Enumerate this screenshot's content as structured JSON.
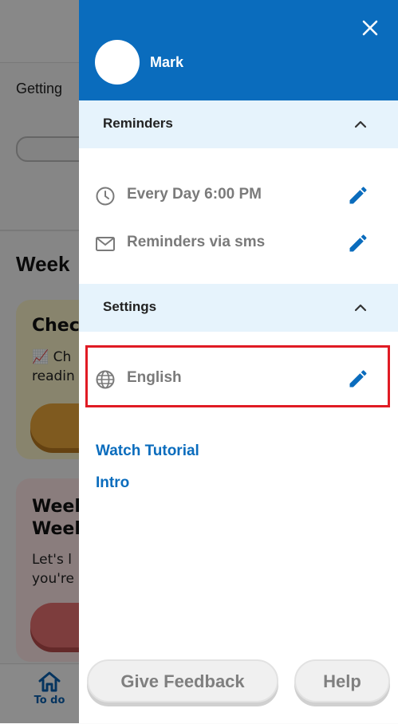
{
  "background": {
    "getting_text": "Getting",
    "week_text": "Week",
    "card1": {
      "title": "Chec",
      "text_line1": "📈 Ch",
      "text_line2": "readin"
    },
    "card2": {
      "title_line1": "Weel",
      "title_line2": "Weel",
      "text_line1": "Let's l",
      "text_line2": "you're"
    },
    "tab_home_label": "To do"
  },
  "drawer": {
    "user_name": "Mark",
    "reminders": {
      "title": "Reminders",
      "items": [
        {
          "label": "Every Day 6:00 PM",
          "icon": "clock-icon"
        },
        {
          "label": "Reminders via sms",
          "icon": "mail-icon"
        }
      ]
    },
    "settings": {
      "title": "Settings",
      "items": [
        {
          "label": "English",
          "icon": "globe-icon"
        }
      ]
    },
    "links": {
      "watch_tutorial": "Watch Tutorial",
      "intro": "Intro"
    },
    "buttons": {
      "give_feedback": "Give Feedback",
      "help": "Help"
    }
  },
  "colors": {
    "header_blue": "#0a6cbd",
    "section_bg": "#e6f3fc",
    "highlight_red": "#e01b24",
    "muted_text": "#7a7a7a"
  }
}
